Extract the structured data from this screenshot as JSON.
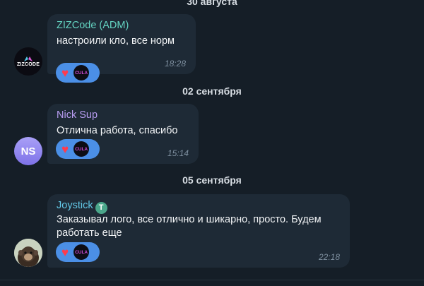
{
  "dates": [
    "30 августа",
    "02 сентября",
    "05 сентября"
  ],
  "messages": [
    {
      "sender": "ZIZCode (ADM)",
      "sender_color": "#64d4c2",
      "text": "настроили кло, все норм",
      "time": "18:28",
      "avatar_text": "ZIZCODE",
      "reaction_emoji": "❤️",
      "reaction_user": "CULA"
    },
    {
      "sender": "Nick Sup",
      "sender_color": "#b79cf0",
      "text": "Отлична работа, спасибо",
      "time": "15:14",
      "avatar_text": "NS",
      "reaction_emoji": "❤️",
      "reaction_user": "CULA"
    },
    {
      "sender": "Joystick",
      "sender_color": "#63c9e8",
      "sender_badge": "T",
      "text_line1": "Заказывал лого, все отлично и шикарно, просто. Будем",
      "text_line2": "работать еще",
      "time": "22:18",
      "avatar_icon": "monkey-avatar",
      "reaction_emoji": "❤️",
      "reaction_user": "CULA"
    }
  ]
}
